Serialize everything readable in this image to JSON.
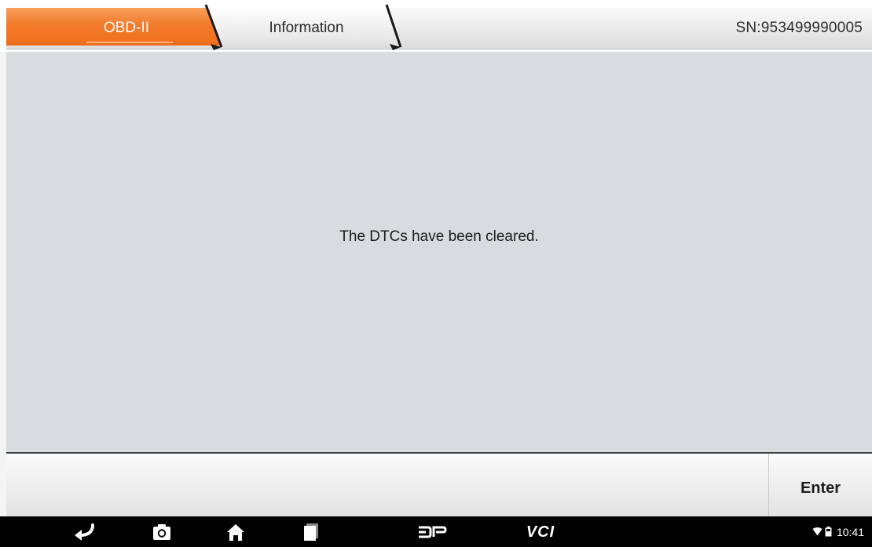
{
  "header": {
    "tabs": [
      {
        "label": "OBD-II",
        "active": true
      },
      {
        "label": "Information",
        "active": false
      }
    ],
    "serial_number": "SN:953499990005"
  },
  "main": {
    "message": "The DTCs have been cleared."
  },
  "actionbar": {
    "enter_label": "Enter"
  },
  "navbar": {
    "icons": [
      "back-icon",
      "screenshot-icon",
      "home-icon",
      "recent-apps-icon",
      "dp-icon",
      "vci-icon"
    ],
    "vci_label": "VCI",
    "status": {
      "icons": [
        "wifi-icon",
        "battery-icon"
      ],
      "time": "10:41"
    }
  },
  "colors": {
    "active_tab": "#f0731f",
    "content_bg": "#d9dcdf",
    "navbar_bg": "#000000"
  }
}
